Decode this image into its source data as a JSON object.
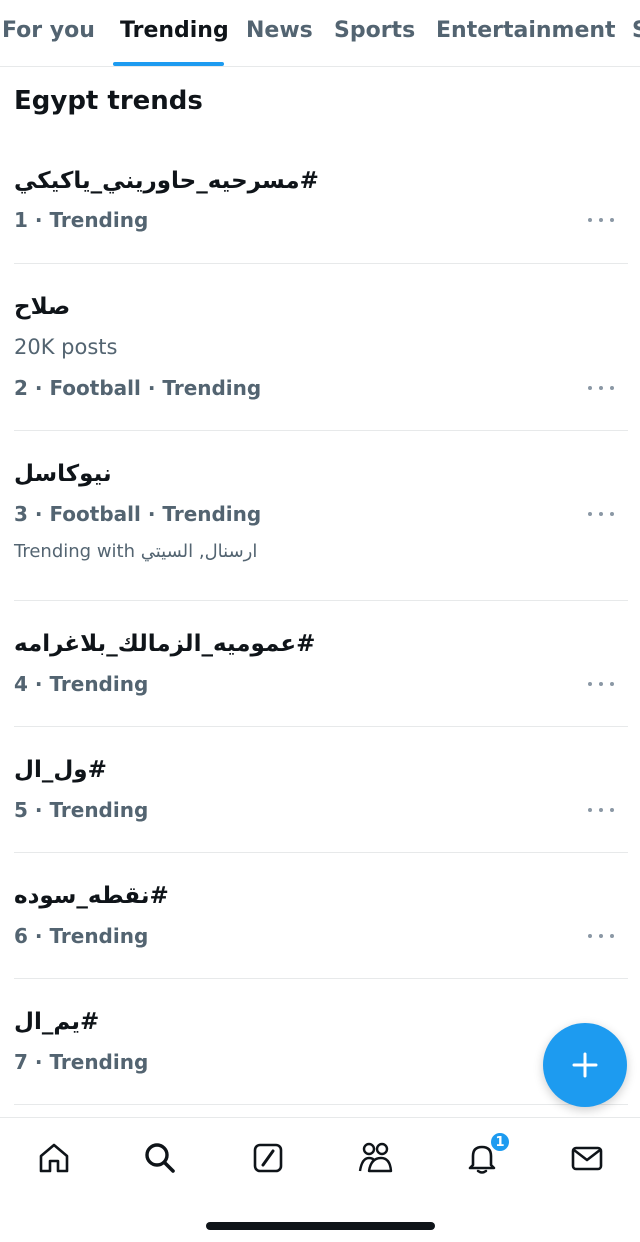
{
  "tabs": [
    {
      "label": "For you",
      "active": false
    },
    {
      "label": "Trending",
      "active": true
    },
    {
      "label": "News",
      "active": false
    },
    {
      "label": "Sports",
      "active": false
    },
    {
      "label": "Entertainment",
      "active": false
    },
    {
      "label": "S",
      "active": false
    }
  ],
  "section_title": "Egypt trends",
  "trends": [
    {
      "name": "#مسرحيه_حاوريني_ياكيكي",
      "meta": "1 · Trending"
    },
    {
      "name": "صلاح",
      "post_count": "20K posts",
      "meta": "2 · Football · Trending"
    },
    {
      "name": "نيوكاسل",
      "meta": "3 · Football · Trending",
      "trending_with_prefix": "Trending with",
      "trending_with_terms": "ارسنال, السيتي"
    },
    {
      "name": "#عموميه_الزمالك_بلاغرامه",
      "meta": "4 · Trending"
    },
    {
      "name": "#ول_ال",
      "meta": "5 · Trending"
    },
    {
      "name": "#نقطه_سوده",
      "meta": "6 · Trending"
    },
    {
      "name": "#يم_ال",
      "meta": "7 · Trending"
    }
  ],
  "icons": {
    "more": "more-horizontal-icon",
    "compose": "plus-icon",
    "home": "home-icon",
    "search": "search-icon",
    "grok": "grok-slash-icon",
    "communities": "communities-icon",
    "notifications": "bell-icon",
    "messages": "mail-icon"
  },
  "notifications_badge": "1",
  "colors": {
    "accent": "#1d9bf0",
    "text": "#0f1419",
    "secondary": "#536471",
    "divider": "#e7e9ea"
  }
}
